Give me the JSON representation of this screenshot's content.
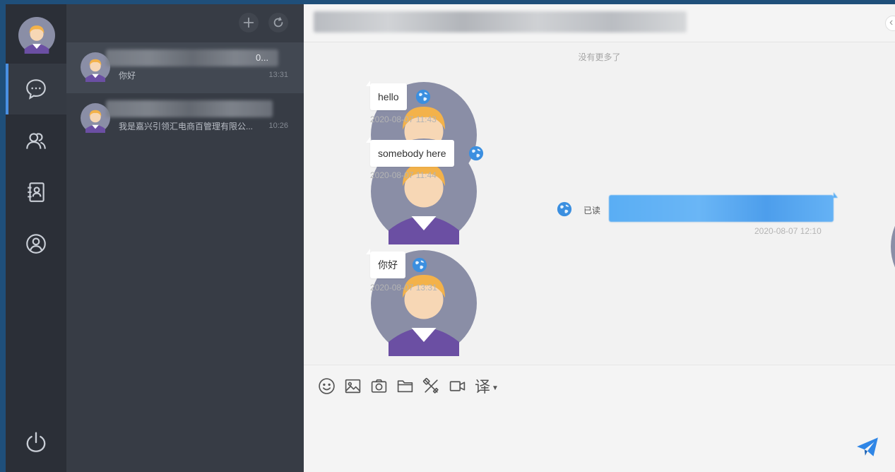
{
  "nav": {
    "items": [
      "chat",
      "contacts",
      "address-book",
      "profile"
    ],
    "active": "chat"
  },
  "conversation_list": {
    "toolbar": {
      "add_label": "+",
      "refresh_label": "refresh"
    },
    "items": [
      {
        "name_tail": "0...",
        "preview": "你好",
        "time": "13:31",
        "active": true
      },
      {
        "name_tail": "",
        "preview": "我是嘉兴引领汇电商百管理有限公...",
        "time": "10:26",
        "active": false
      }
    ]
  },
  "chat": {
    "no_more_text": "没有更多了",
    "messages": [
      {
        "side": "left",
        "text": "hello",
        "time": "2020-08-07 11:43"
      },
      {
        "side": "left",
        "text": "somebody here",
        "time": "2020-08-07 11:44"
      },
      {
        "side": "right",
        "text": "",
        "status": "已读",
        "time": "2020-08-07 12:10"
      },
      {
        "side": "left",
        "text": "你好",
        "time": "2020-08-07 13:31"
      }
    ],
    "input": {
      "tools": [
        "emoji-icon",
        "image-icon",
        "camera-icon",
        "folder-icon",
        "scissors-icon",
        "video-icon"
      ],
      "translate_label": "译",
      "send": "send-icon"
    }
  },
  "colors": {
    "accent": "#4a90e2",
    "rail": "#2b2f37",
    "list": "#373c45",
    "chat_bg": "#f2f2f2",
    "send": "#2f86e6"
  }
}
